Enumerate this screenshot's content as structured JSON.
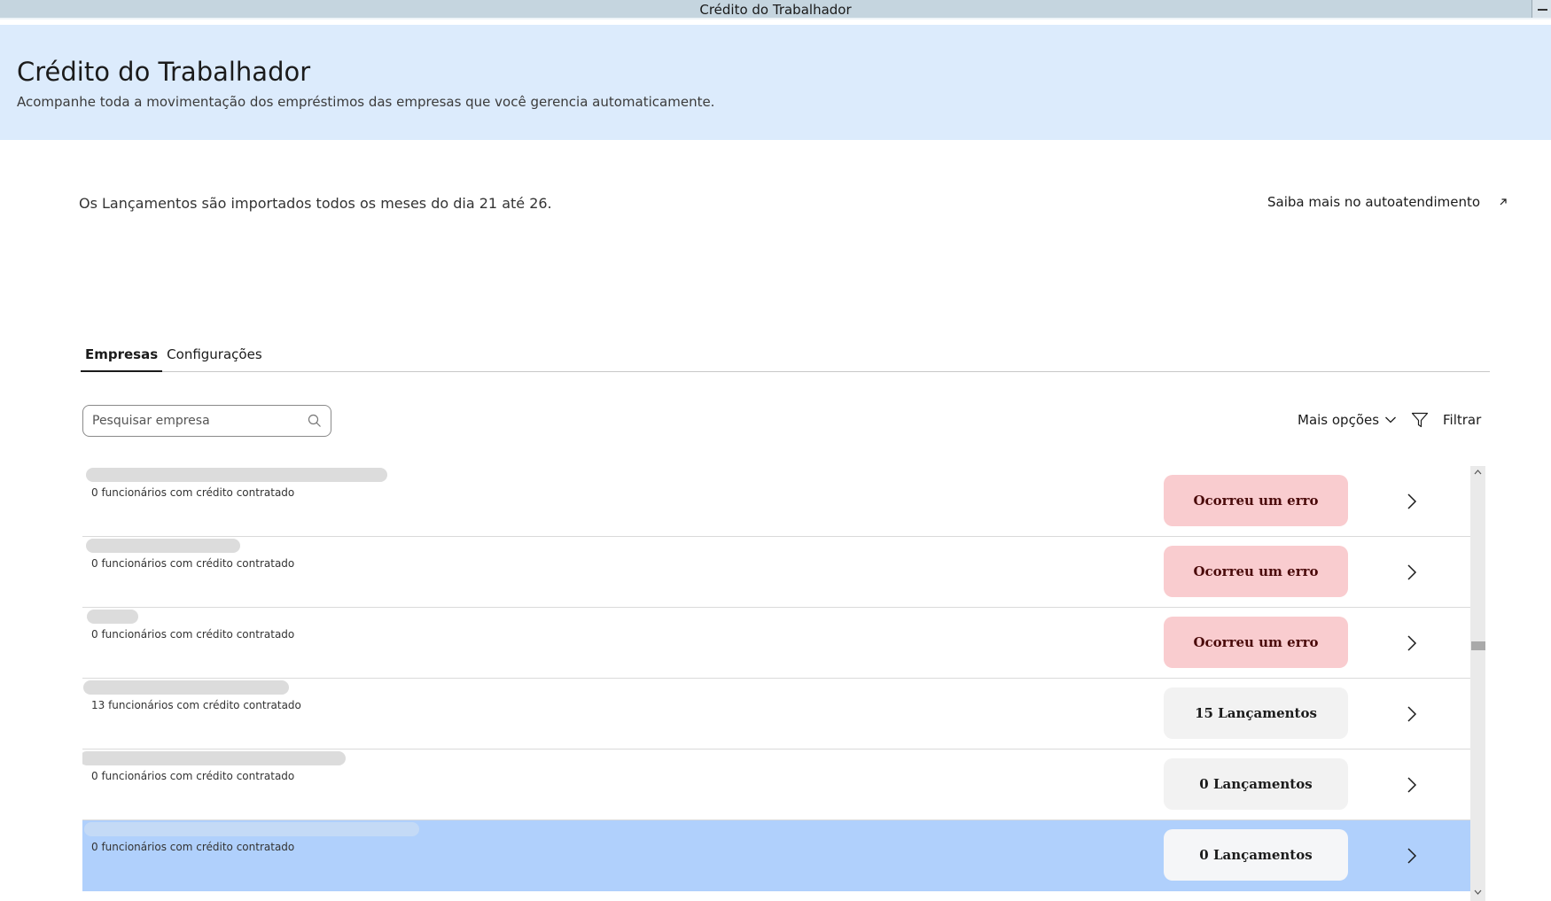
{
  "window": {
    "title": "Crédito do Trabalhador"
  },
  "header": {
    "title": "Crédito do Trabalhador",
    "subtitle": "Acompanhe toda a movimentação dos empréstimos das empresas que você gerencia automaticamente."
  },
  "info": {
    "text": "Os Lançamentos são importados todos os meses do dia 21 até 26.",
    "link_label": "Saiba mais no autoatendimento"
  },
  "tabs": [
    {
      "label": "Empresas",
      "active": true
    },
    {
      "label": "Configurações",
      "active": false
    }
  ],
  "toolbar": {
    "search_placeholder": "Pesquisar empresa",
    "more_options_label": "Mais opções",
    "filter_label": "Filtrar"
  },
  "companies": [
    {
      "employees_text": "0 funcionários com crédito contratado",
      "status": "Ocorreu um erro",
      "status_type": "error",
      "selected": false
    },
    {
      "employees_text": "0 funcionários com crédito contratado",
      "status": "Ocorreu um erro",
      "status_type": "error",
      "selected": false
    },
    {
      "employees_text": "0 funcionários com crédito contratado",
      "status": "Ocorreu um erro",
      "status_type": "error",
      "selected": false
    },
    {
      "employees_text": "13 funcionários com crédito contratado",
      "status": "15 Lançamentos",
      "status_type": "ok",
      "selected": false
    },
    {
      "employees_text": "0 funcionários com crédito contratado",
      "status": "0 Lançamentos",
      "status_type": "ok",
      "selected": false
    },
    {
      "employees_text": "0 funcionários com crédito contratado",
      "status": "0 Lançamentos",
      "status_type": "ok",
      "selected": true
    }
  ],
  "colors": {
    "header_bg": "#dcebfc",
    "error_badge": "#f9cccf",
    "neutral_badge": "#f2f2f2",
    "selected_row": "#b0d0fc"
  }
}
